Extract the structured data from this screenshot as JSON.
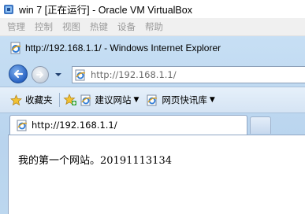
{
  "vbox": {
    "title": "win 7 [正在运行] - Oracle VM VirtualBox",
    "menu": [
      "管理",
      "控制",
      "视图",
      "热键",
      "设备",
      "帮助"
    ]
  },
  "ie": {
    "window_title": "http://192.168.1.1/ - Windows Internet Explorer",
    "address": "http://192.168.1.1/",
    "favorites": {
      "label": "收藏夹",
      "suggested_sites": "建议网站",
      "web_slice_gallery": "网页快讯库"
    },
    "tab_title": "http://192.168.1.1/",
    "page_text": "我的第一个网站。20191113134"
  },
  "icons": {
    "vbox_app": "virtualbox-icon",
    "ie_page": "ie-page-icon",
    "back": "back-arrow-icon",
    "forward": "forward-arrow-icon",
    "favorites_star": "star-icon",
    "add_favorite": "add-favorite-icon"
  },
  "colors": {
    "ie_frame": "#c7dff4",
    "back_button": "#2a64c4",
    "menu_disabled": "#9a9a9a"
  }
}
